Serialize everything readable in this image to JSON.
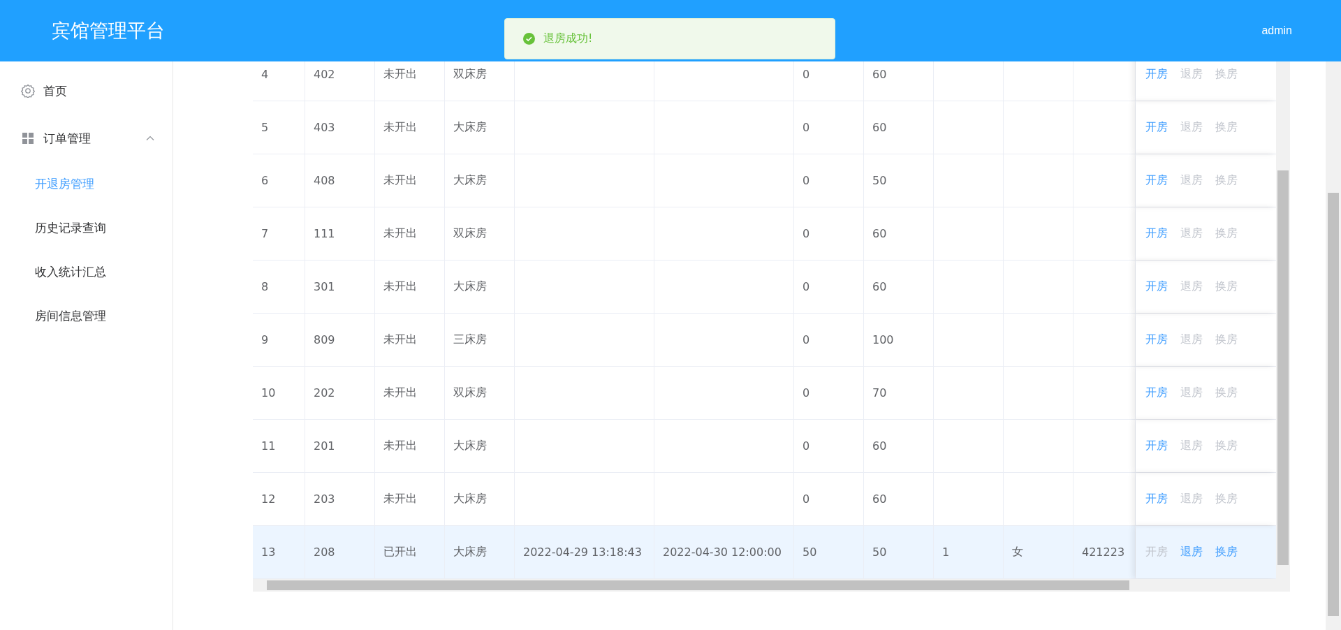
{
  "header": {
    "title": "宾馆管理平台",
    "user": "admin"
  },
  "toast": {
    "message": "退房成功!"
  },
  "sidebar": {
    "items": [
      {
        "label": "首页"
      },
      {
        "label": "订单管理",
        "expanded": true,
        "children": [
          {
            "label": "开退房管理",
            "selected": true
          },
          {
            "label": "历史记录查询",
            "selected": false
          },
          {
            "label": "收入统计汇总",
            "selected": false
          },
          {
            "label": "房间信息管理",
            "selected": false
          }
        ]
      }
    ]
  },
  "table": {
    "rows": [
      {
        "selected": false,
        "column_1": "4",
        "column_2": "402",
        "column_3": "未开出",
        "column_4": "双床房",
        "column_7": "0",
        "column_8": "60",
        "actions": [
          {
            "label": "开房",
            "disabled": false
          },
          {
            "label": "退房",
            "disabled": true
          },
          {
            "label": "换房",
            "disabled": true
          }
        ]
      },
      {
        "selected": false,
        "column_1": "5",
        "column_2": "403",
        "column_3": "未开出",
        "column_4": "大床房",
        "column_7": "0",
        "column_8": "60",
        "actions": [
          {
            "label": "开房",
            "disabled": false
          },
          {
            "label": "退房",
            "disabled": true
          },
          {
            "label": "换房",
            "disabled": true
          }
        ]
      },
      {
        "selected": false,
        "column_1": "6",
        "column_2": "408",
        "column_3": "未开出",
        "column_4": "大床房",
        "column_7": "0",
        "column_8": "50",
        "actions": [
          {
            "label": "开房",
            "disabled": false
          },
          {
            "label": "退房",
            "disabled": true
          },
          {
            "label": "换房",
            "disabled": true
          }
        ]
      },
      {
        "selected": false,
        "column_1": "7",
        "column_2": "111",
        "column_3": "未开出",
        "column_4": "双床房",
        "column_7": "0",
        "column_8": "60",
        "actions": [
          {
            "label": "开房",
            "disabled": false
          },
          {
            "label": "退房",
            "disabled": true
          },
          {
            "label": "换房",
            "disabled": true
          }
        ]
      },
      {
        "selected": false,
        "column_1": "8",
        "column_2": "301",
        "column_3": "未开出",
        "column_4": "大床房",
        "column_7": "0",
        "column_8": "60",
        "actions": [
          {
            "label": "开房",
            "disabled": false
          },
          {
            "label": "退房",
            "disabled": true
          },
          {
            "label": "换房",
            "disabled": true
          }
        ]
      },
      {
        "selected": false,
        "column_1": "9",
        "column_2": "809",
        "column_3": "未开出",
        "column_4": "三床房",
        "column_7": "0",
        "column_8": "100",
        "actions": [
          {
            "label": "开房",
            "disabled": false
          },
          {
            "label": "退房",
            "disabled": true
          },
          {
            "label": "换房",
            "disabled": true
          }
        ]
      },
      {
        "selected": false,
        "column_1": "10",
        "column_2": "202",
        "column_3": "未开出",
        "column_4": "双床房",
        "column_7": "0",
        "column_8": "70",
        "actions": [
          {
            "label": "开房",
            "disabled": false
          },
          {
            "label": "退房",
            "disabled": true
          },
          {
            "label": "换房",
            "disabled": true
          }
        ]
      },
      {
        "selected": false,
        "column_1": "11",
        "column_2": "201",
        "column_3": "未开出",
        "column_4": "大床房",
        "column_7": "0",
        "column_8": "60",
        "actions": [
          {
            "label": "开房",
            "disabled": false
          },
          {
            "label": "退房",
            "disabled": true
          },
          {
            "label": "换房",
            "disabled": true
          }
        ]
      },
      {
        "selected": false,
        "column_1": "12",
        "column_2": "203",
        "column_3": "未开出",
        "column_4": "大床房",
        "column_7": "0",
        "column_8": "60",
        "actions": [
          {
            "label": "开房",
            "disabled": false
          },
          {
            "label": "退房",
            "disabled": true
          },
          {
            "label": "换房",
            "disabled": true
          }
        ]
      },
      {
        "selected": true,
        "column_1": "13",
        "column_2": "208",
        "column_3": "已开出",
        "column_4": "大床房",
        "column_5": "2022-04-29 13:18:43",
        "column_6": "2022-04-30 12:00:00",
        "column_7": "50",
        "column_8": "50",
        "column_9": "1",
        "column_10": "女",
        "column_11": "421223",
        "actions": [
          {
            "label": "开房",
            "disabled": true
          },
          {
            "label": "退房",
            "disabled": false
          },
          {
            "label": "换房",
            "disabled": false
          }
        ]
      }
    ]
  }
}
